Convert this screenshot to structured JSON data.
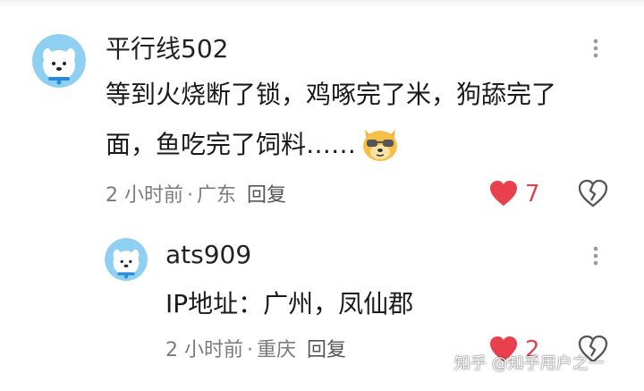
{
  "comment": {
    "username": "平行线502",
    "text_line1": "等到火烧断了锁，鸡啄完了米，狗舔完了",
    "text_line2": "面，鱼吃完了饲料……",
    "emoji_icon": "doge-sunglasses-emoji",
    "time": "2 小时前",
    "separator": "·",
    "location": "广东",
    "reply_label": "回复",
    "like_count": "7"
  },
  "reply": {
    "username": "ats909",
    "text": "IP地址：广州，凤仙郡",
    "time": "2 小时前",
    "separator": "·",
    "location": "重庆",
    "reply_label": "回复",
    "like_count": "2"
  },
  "watermark": "知乎 @知乎用户之一",
  "colors": {
    "like_red": "#e8414d",
    "meta_gray": "#7b7b7b",
    "avatar_blue": "#8fd0f2"
  }
}
